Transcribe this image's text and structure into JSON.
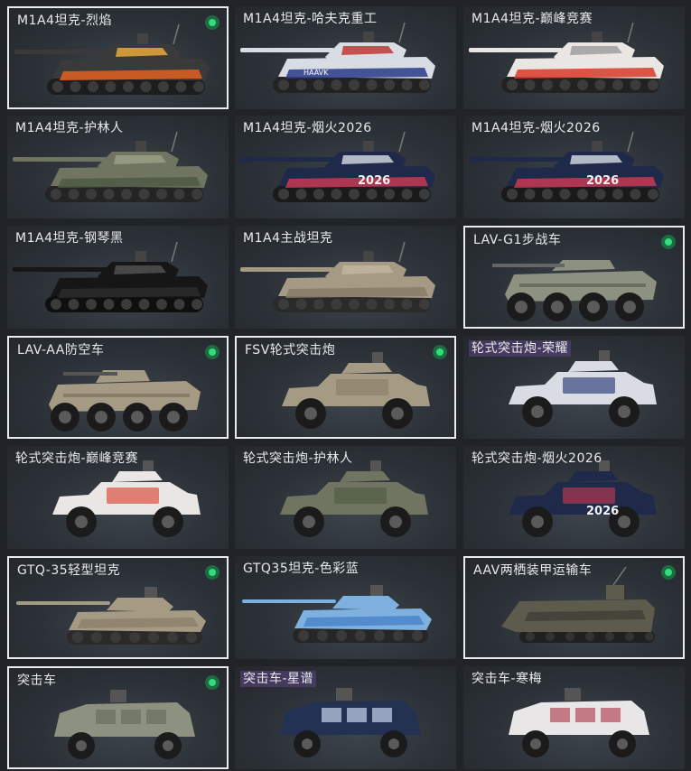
{
  "vehicles": [
    {
      "name": "M1A4坦克-烈焰",
      "owned": true,
      "selected": true,
      "kind": "tank",
      "paint": "flame",
      "highlight": false
    },
    {
      "name": "M1A4坦克-哈夫克重工",
      "owned": false,
      "selected": false,
      "kind": "tank",
      "paint": "haavk",
      "highlight": false
    },
    {
      "name": "M1A4坦克-巅峰竞赛",
      "owned": false,
      "selected": false,
      "kind": "tank",
      "paint": "redwhite",
      "highlight": false
    },
    {
      "name": "M1A4坦克-护林人",
      "owned": false,
      "selected": false,
      "kind": "tank",
      "paint": "forest",
      "highlight": false
    },
    {
      "name": "M1A4坦克-烟火2026",
      "owned": false,
      "selected": false,
      "kind": "tank",
      "paint": "fireworks",
      "highlight": false
    },
    {
      "name": "M1A4坦克-烟火2026",
      "owned": false,
      "selected": false,
      "kind": "tank",
      "paint": "fireworks",
      "highlight": false
    },
    {
      "name": "M1A4坦克-钢琴黑",
      "owned": false,
      "selected": false,
      "kind": "tank",
      "paint": "black",
      "highlight": false
    },
    {
      "name": "M1A4主战坦克",
      "owned": false,
      "selected": false,
      "kind": "tank",
      "paint": "desert",
      "highlight": false
    },
    {
      "name": "LAV-G1步战车",
      "owned": true,
      "selected": true,
      "kind": "lav",
      "paint": "green",
      "highlight": false
    },
    {
      "name": "LAV-AA防空车",
      "owned": true,
      "selected": true,
      "kind": "lavaa",
      "paint": "desert",
      "highlight": false
    },
    {
      "name": "FSV轮式突击炮",
      "owned": true,
      "selected": true,
      "kind": "fsv",
      "paint": "desert",
      "highlight": false
    },
    {
      "name": "轮式突击炮-荣耀",
      "owned": false,
      "selected": false,
      "kind": "fsv",
      "paint": "glory",
      "highlight": true
    },
    {
      "name": "轮式突击炮-巅峰竞赛",
      "owned": false,
      "selected": false,
      "kind": "fsv",
      "paint": "redwhite",
      "highlight": false
    },
    {
      "name": "轮式突击炮-护林人",
      "owned": false,
      "selected": false,
      "kind": "fsv",
      "paint": "forest",
      "highlight": false
    },
    {
      "name": "轮式突击炮-烟火2026",
      "owned": false,
      "selected": false,
      "kind": "fsv",
      "paint": "fireworks",
      "highlight": false
    },
    {
      "name": "GTQ-35轻型坦克",
      "owned": true,
      "selected": true,
      "kind": "light",
      "paint": "desert",
      "highlight": false
    },
    {
      "name": "GTQ35坦克-色彩蓝",
      "owned": false,
      "selected": false,
      "kind": "light",
      "paint": "blue",
      "highlight": false
    },
    {
      "name": "AAV两栖装甲运输车",
      "owned": true,
      "selected": true,
      "kind": "aav",
      "paint": "olive",
      "highlight": false
    },
    {
      "name": "突击车",
      "owned": true,
      "selected": true,
      "kind": "assault",
      "paint": "green",
      "highlight": false
    },
    {
      "name": "突击车-星谱",
      "owned": false,
      "selected": false,
      "kind": "assault",
      "paint": "starry",
      "highlight": true
    },
    {
      "name": "突击车-寒梅",
      "owned": false,
      "selected": false,
      "kind": "assault",
      "paint": "plum",
      "highlight": false
    }
  ],
  "overlay_text": {
    "fireworks_year": "2026",
    "haavk_logo": "HAAVK"
  },
  "colors": {
    "owned_dot": "#2fe07a",
    "selected_border": "#e9ecef",
    "tag_bg": "#5a4682"
  }
}
